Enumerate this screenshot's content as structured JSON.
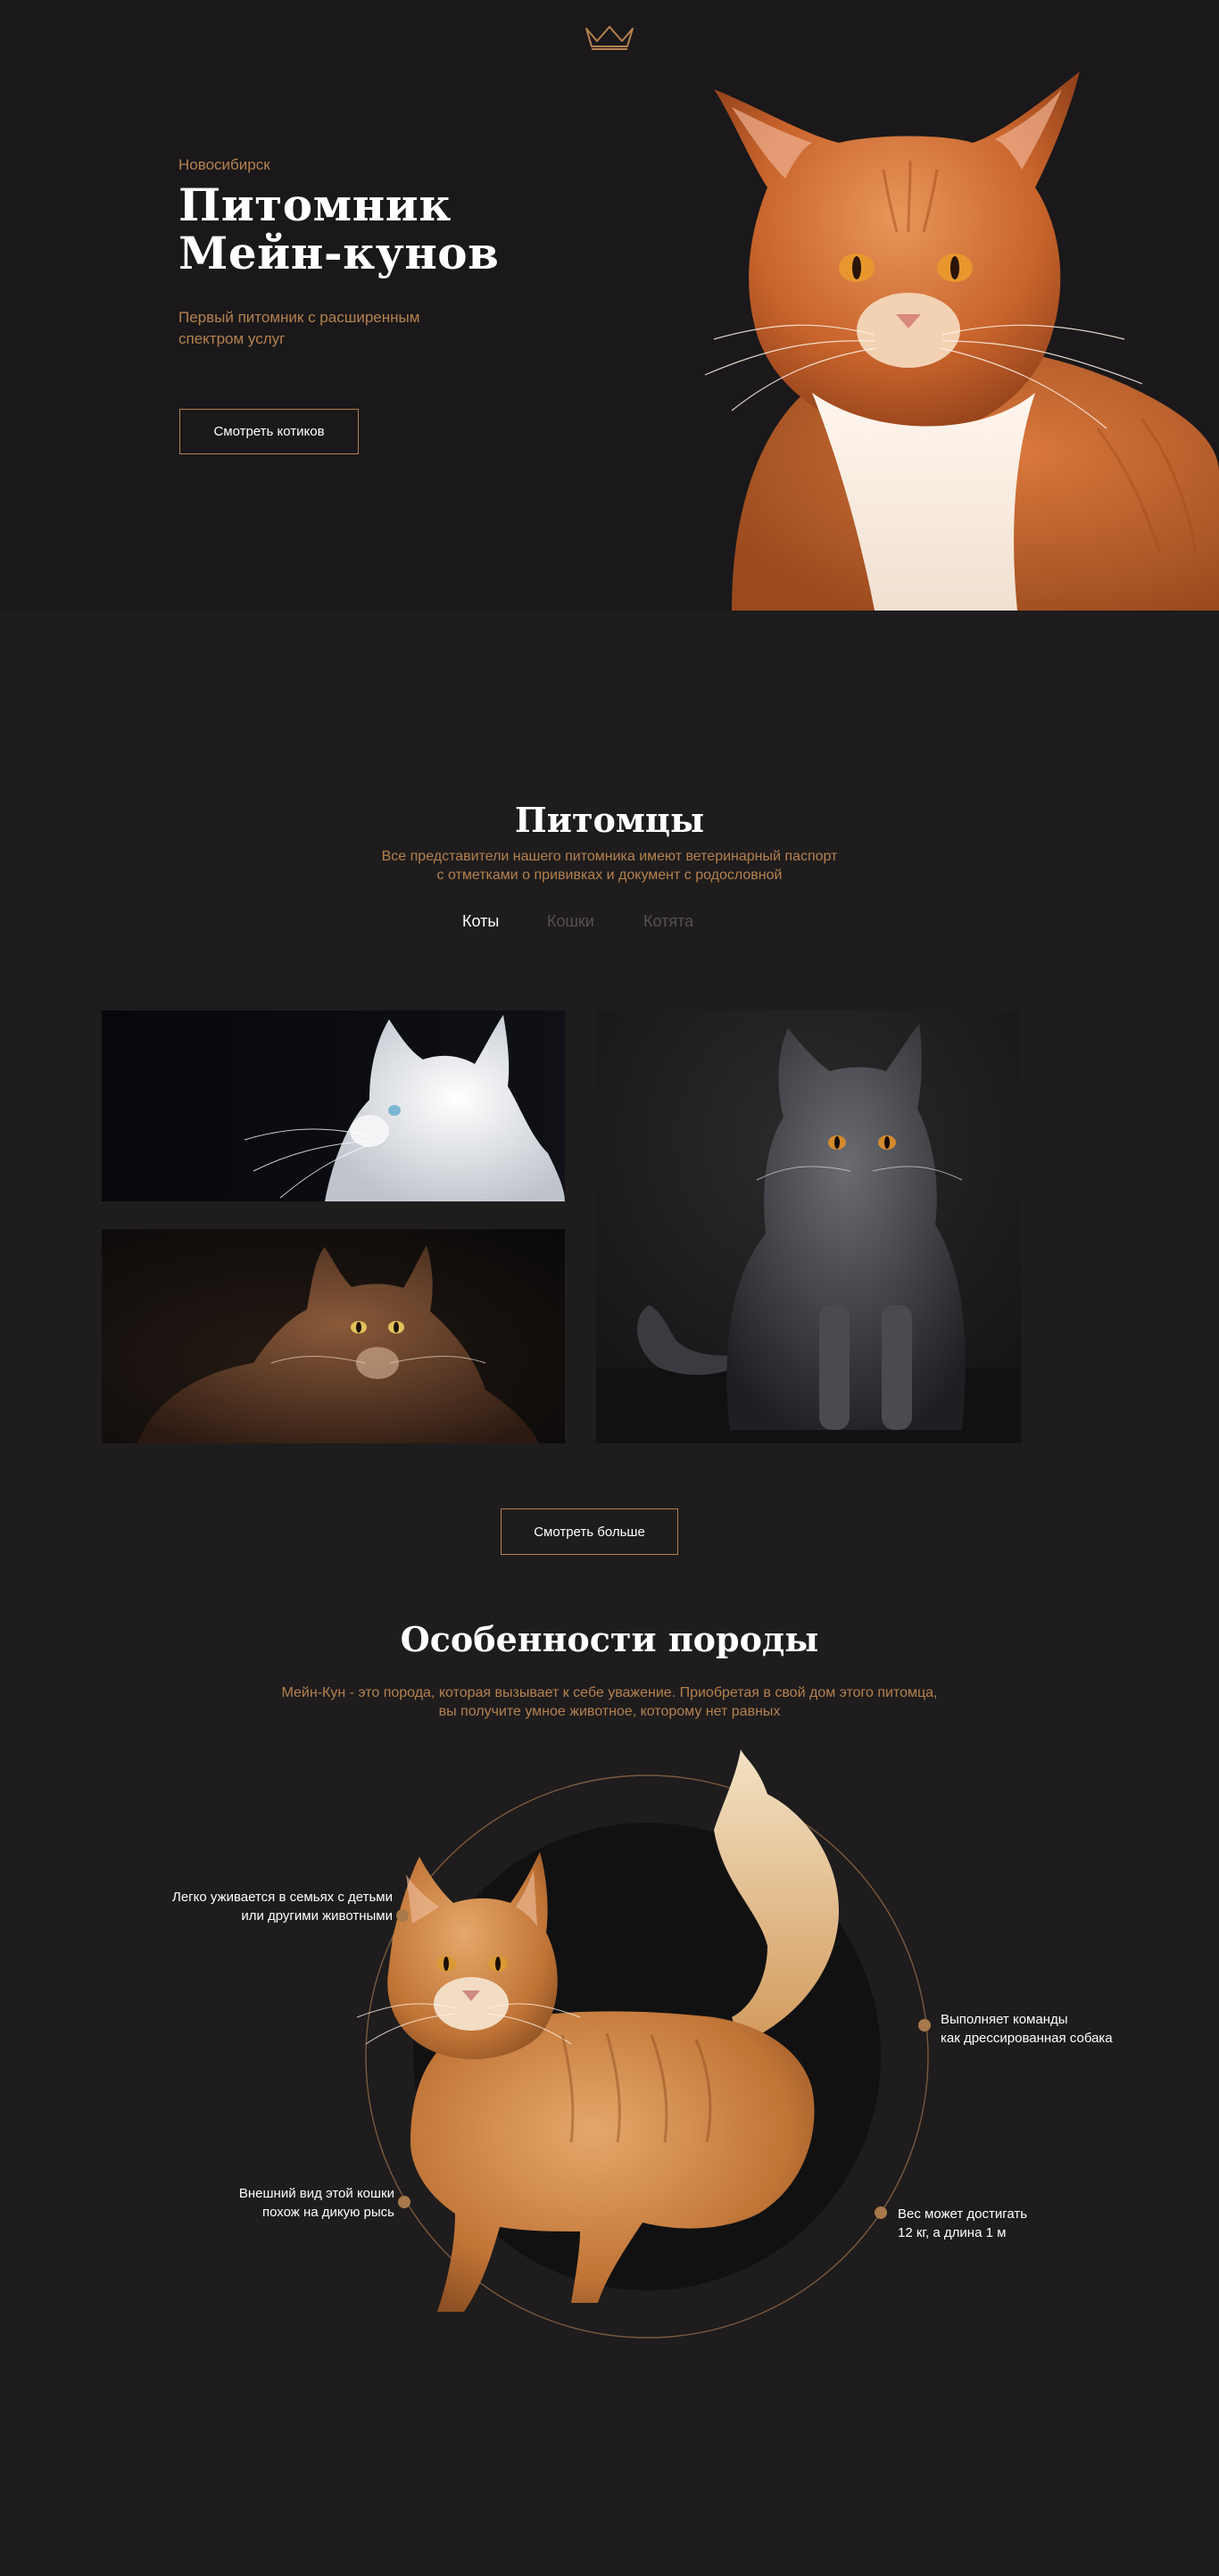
{
  "colors": {
    "accent": "#b5814e",
    "background": "#1e1c1d",
    "hero_background": "#1a181a",
    "tab_inactive": "#55514f"
  },
  "header": {
    "logo_icon": "crown-icon"
  },
  "hero": {
    "city": "Новосибирск",
    "title_line1": "Питомник",
    "title_line2": "Мейн-кунов",
    "subtitle": "Первый питомник с расширенным спектром услуг",
    "cta_label": "Смотреть котиков"
  },
  "pets": {
    "title": "Питомцы",
    "subtitle_line1": "Все представители нашего питомника имеют ветеринарный паспорт",
    "subtitle_line2": "с отметками о прививках и документ с родословной",
    "tabs": [
      {
        "label": "Коты",
        "active": true
      },
      {
        "label": "Кошки",
        "active": false
      },
      {
        "label": "Котята",
        "active": false
      }
    ],
    "more_label": "Смотреть больше"
  },
  "features": {
    "title": "Особенности породы",
    "subtitle_line1": "Мейн-Кун - это порода, которая вызывает к себе уважение. Приобретая в свой дом этого питомца,",
    "subtitle_line2": "вы получите умное животное, которому нет равных",
    "items": [
      {
        "line1": "Легко уживается в семьях с детьми",
        "line2": "или другими животными"
      },
      {
        "line1": "Выполняет команды",
        "line2": "как дрессированная собака"
      },
      {
        "line1": "Внешний вид этой кошки",
        "line2": "похож на дикую рысь"
      },
      {
        "line1": "Вес может достигать",
        "line2": "12 кг, а длина 1 м"
      }
    ]
  }
}
